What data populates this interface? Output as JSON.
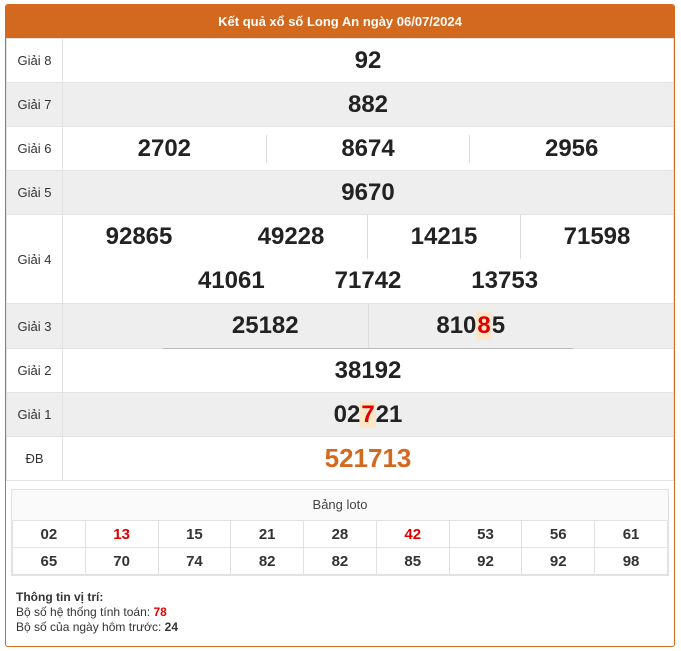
{
  "header": {
    "title": "Kết quả xổ số Long An ngày 06/07/2024"
  },
  "results": {
    "g8": {
      "label": "Giải 8",
      "values": [
        "92"
      ]
    },
    "g7": {
      "label": "Giải 7",
      "values": [
        "882"
      ]
    },
    "g6": {
      "label": "Giải 6",
      "values": [
        "2702",
        "8674",
        "2956"
      ]
    },
    "g5": {
      "label": "Giải 5",
      "values": [
        "9670"
      ]
    },
    "g4": {
      "label": "Giải 4",
      "values": [
        "92865",
        "49228",
        "14215",
        "71598",
        "41061",
        "71742",
        "13753"
      ]
    },
    "g3": {
      "label": "Giải 3",
      "values": [
        "25182"
      ],
      "v2_pre": "810",
      "v2_hl": "8",
      "v2_post": "5"
    },
    "g2": {
      "label": "Giải 2",
      "values": [
        "38192"
      ]
    },
    "g1": {
      "label": "Giải 1",
      "pre": "02",
      "hl": "7",
      "post": "21"
    },
    "db": {
      "label": "ĐB",
      "value": "521713"
    }
  },
  "loto": {
    "title": "Bảng loto",
    "rows": [
      [
        "02",
        "13",
        "15",
        "21",
        "28",
        "42",
        "53",
        "56",
        "61"
      ],
      [
        "65",
        "70",
        "74",
        "82",
        "82",
        "85",
        "92",
        "92",
        "98"
      ]
    ],
    "highlight": [
      "13",
      "42"
    ],
    "highlight_color": "#e00000"
  },
  "info": {
    "title": "Thông tin vị trí:",
    "line1_label": "Bộ số hệ thống tính toán: ",
    "line1_value": "78",
    "line2_label": "Bộ số của ngày hôm trước: ",
    "line2_value": "24"
  },
  "colors": {
    "accent": "#d2691e",
    "highlight": "#e00000",
    "row_alt": "#eeeeee"
  }
}
